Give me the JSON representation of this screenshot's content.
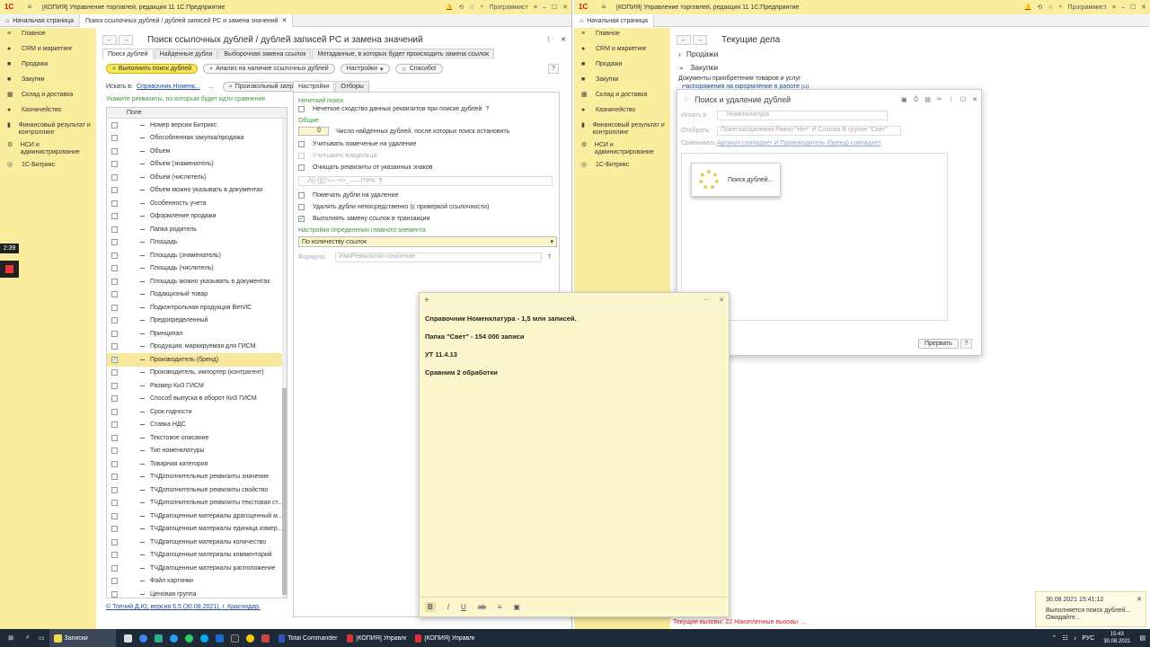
{
  "left_window": {
    "title": "[КОПИЯ] Управление торговлей, редакция 11 1С:Предприятие",
    "user": "Программист",
    "tabs": [
      "Начальная страница",
      "Поиск ссылочных дублей / дублей записей РС и замена значений"
    ],
    "sidebar": [
      "Главное",
      "CRM и маркетинг",
      "Продажи",
      "Закупки",
      "Склад и доставка",
      "Казначейство",
      "Финансовый результат и контроллинг",
      "НСИ и администрирование",
      "1С-Битрикс"
    ],
    "page_title": "Поиск ссылочных дублей / дублей записей РС и замена значений",
    "top_tabs": [
      "Поиск дублей",
      "Найденные дубли",
      "Выборочная замена ссылок",
      "Метаданные, в которых будет происходить замена ссылок"
    ],
    "toolbar": {
      "run": "Выполнить поиск дублей",
      "analyze": "Анализ на наличие ссылочных дублей",
      "settings": "Настройки",
      "thanks": "Спасибо!",
      "help": "?"
    },
    "search_in_label": "Искать в:",
    "search_in_value": "Справочник.Номенк...",
    "arbitrary_query": "Произвольный запрос",
    "attrs_label": "Укажите реквизиты, по которым будет идти сравнение",
    "list_header": "Поле",
    "fields": [
      {
        "name": "Номер версии Битрикс",
        "checked": false
      },
      {
        "name": "Обособленная закупка/продажа",
        "checked": false
      },
      {
        "name": "Объем",
        "checked": false
      },
      {
        "name": "Объем (знаменатель)",
        "checked": false
      },
      {
        "name": "Объем (числитель)",
        "checked": false
      },
      {
        "name": "Объем можно указывать в документах",
        "checked": false
      },
      {
        "name": "Особенность учета",
        "checked": false
      },
      {
        "name": "Оформление продажи",
        "checked": false
      },
      {
        "name": "Папка родитель",
        "checked": false
      },
      {
        "name": "Площадь",
        "checked": false
      },
      {
        "name": "Площадь (знаменатель)",
        "checked": false
      },
      {
        "name": "Площадь (числитель)",
        "checked": false
      },
      {
        "name": "Площадь можно указывать в документах",
        "checked": false
      },
      {
        "name": "Подакцизный товар",
        "checked": false
      },
      {
        "name": "Подконтрольная продукция ВетИС",
        "checked": false
      },
      {
        "name": "Предопределенный",
        "checked": false
      },
      {
        "name": "Принципал",
        "checked": false
      },
      {
        "name": "Продукция, маркируемая для ГИСМ",
        "checked": false
      },
      {
        "name": "Производитель (бренд)",
        "checked": true
      },
      {
        "name": "Производитель, импортер (контрагент)",
        "checked": false
      },
      {
        "name": "Размер КиЗ ГИСМ",
        "checked": false
      },
      {
        "name": "Способ выпуска в оборот КиЗ ГИСМ",
        "checked": false
      },
      {
        "name": "Срок годности",
        "checked": false
      },
      {
        "name": "Ставка НДС",
        "checked": false
      },
      {
        "name": "Текстовое описание",
        "checked": false
      },
      {
        "name": "Тип номенклатуры",
        "checked": false
      },
      {
        "name": "Товарная категория",
        "checked": false
      },
      {
        "name": "ТЧДополнительные реквизиты значение",
        "checked": false
      },
      {
        "name": "ТЧДополнительные реквизиты свойство",
        "checked": false
      },
      {
        "name": "ТЧДополнительные реквизиты текстовая ст...",
        "checked": false
      },
      {
        "name": "ТЧДрагоценные материалы драгоценный м...",
        "checked": false
      },
      {
        "name": "ТЧДрагоценные материалы единица измер...",
        "checked": false
      },
      {
        "name": "ТЧДрагоценные материалы количество",
        "checked": false
      },
      {
        "name": "ТЧДрагоценные материалы комментарий",
        "checked": false
      },
      {
        "name": "ТЧДрагоценные материалы расположение",
        "checked": false
      },
      {
        "name": "Файл картинки",
        "checked": false
      },
      {
        "name": "Ценовая группа",
        "checked": false
      }
    ],
    "settings_tabs": [
      "Настройки",
      "Отборы"
    ],
    "fuzzy_header": "Нечеткий поиск",
    "fuzzy_check": "Нечеткое сходство данных реквизитов при поиске дублей",
    "general_header": "Общие",
    "stop_count": "0",
    "stop_label": "Число найденных дублей, после которых поиск остановить",
    "opt_marked": "Учитывать помеченые на удаление",
    "opt_owner": "Учитывать владельца",
    "opt_clear": "Очищать реквизиты от указанных знаков",
    "chars_value": ".,/\\()-[]{}\"«»~<>_—–:!?#%¨  ¶",
    "opt_mark_dups": "Помечать дубли на удаление",
    "opt_delete": "Удалять дубли непосредственно (с проверкой ссылочности)",
    "opt_replace": "Выполнять замену ссылок в транзакции",
    "main_elem_header": "Настройки определения главного элемента",
    "main_elem_value": "По количеству ссылок",
    "formula_label": "Формула:",
    "formula_placeholder": "ИмяРеквизита>=значение",
    "footer_link": "© Топчий Д.Ю, версия 6.5 (30.08.2021), г. Краснодар."
  },
  "right_window": {
    "title": "[КОПИЯ] Управление торговлей, редакция 11 1С:Предприятие",
    "user": "Программист",
    "tabs": [
      "Начальная страница"
    ],
    "sidebar": [
      "Главное",
      "CRM и маркетинг",
      "Продажи",
      "Закупки",
      "Склад и доставка",
      "Казначейство",
      "Финансовый результат и контроллинг",
      "НСИ и администрирование",
      "1С-Битрикс"
    ],
    "page_title": "Текущие дела",
    "sections": [
      "Продажи",
      "Закупки"
    ],
    "purchase_doc": "Документы приобретения товаров и услуг",
    "purchase_sub": "Распоряжения на оформление в работе (0)",
    "calls": "Текущие вызовы: 22  Накопленные вызовы: ...",
    "dialog": {
      "title": "Поиск и удаление дублей",
      "search_in_label": "Искать в:",
      "search_in_value": "Номенклатура",
      "filter_label": "Отобрать:",
      "filter_value": "ПометкаУдаления Равно \"Нет\" И Ссылка В группе \"Свет\"",
      "compare_label": "Сравнивать:",
      "compare_value": "Артикул совпадает И Производитель (бренд) совпадает",
      "progress_text": "Поиск дублей...",
      "abort": "Прервать",
      "help": "?"
    }
  },
  "note": {
    "lines": [
      "Справочник Номенклатура - 1,5 млн записей.",
      "Папка \"Свет\" - 154 000 записи",
      "УТ 11.4.13",
      "Сравним 2 обработки"
    ],
    "tools": [
      "B",
      "I",
      "U",
      "ab",
      "≡",
      "▣"
    ]
  },
  "timer": "2:39",
  "taskbar": {
    "apps": [
      "Записки",
      "Total Commander (...",
      "[КОПИЯ] Управле...",
      "[КОПИЯ] Управле..."
    ],
    "lang": "РУС",
    "time": "15:43",
    "date": "30.08.2021"
  },
  "toast": {
    "datetime": "30.08.2021 15:41:12",
    "text": "Выполняется поиск дублей... Ожидайте..."
  },
  "colors": {
    "accent": "#fbed9e",
    "run_button": "#f7e55a",
    "green": "#3c9640",
    "link": "#244a9e"
  }
}
